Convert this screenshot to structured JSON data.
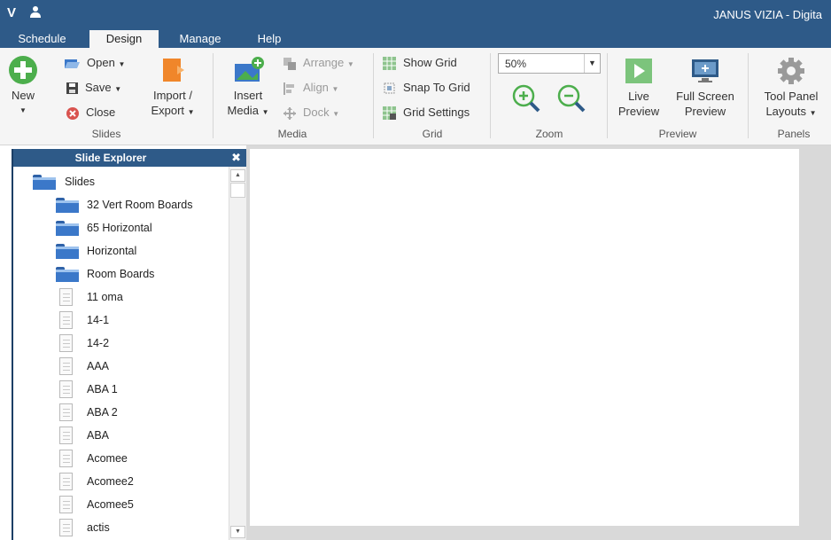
{
  "app": {
    "letter": "V",
    "title": "JANUS VIZIA - Digita"
  },
  "tabs": [
    "Schedule",
    "Design",
    "Manage",
    "Help"
  ],
  "ribbon": {
    "slides": {
      "new": "New",
      "open": "Open",
      "save": "Save",
      "close": "Close",
      "import": "Import /",
      "export": "Export",
      "label": "Slides"
    },
    "media": {
      "insert": "Insert",
      "media": "Media",
      "arrange": "Arrange",
      "align": "Align",
      "dock": "Dock",
      "label": "Media"
    },
    "grid": {
      "show": "Show Grid",
      "snap": "Snap To Grid",
      "settings": "Grid Settings",
      "label": "Grid"
    },
    "zoom": {
      "value": "50%",
      "label": "Zoom"
    },
    "preview": {
      "live1": "Live",
      "live2": "Preview",
      "full1": "Full Screen",
      "full2": "Preview",
      "label": "Preview"
    },
    "panels": {
      "tool1": "Tool Panel",
      "tool2": "Layouts",
      "label": "Panels"
    }
  },
  "explorer": {
    "title": "Slide Explorer",
    "root": "Slides",
    "folders": [
      "32 Vert Room Boards",
      "65 Horizontal",
      "Horizontal",
      "Room Boards"
    ],
    "slides": [
      "11 oma",
      "14-1",
      "14-2",
      "AAA",
      "ABA 1",
      "ABA 2",
      "ABA",
      "Acomee",
      "Acomee2",
      "Acomee5",
      "actis"
    ]
  },
  "colors": {
    "titlebar": "#2e5a88",
    "ribbon": "#f5f5f5",
    "folder": "#3b78c9",
    "add": "#4cae4c",
    "close": "#d9534f"
  }
}
